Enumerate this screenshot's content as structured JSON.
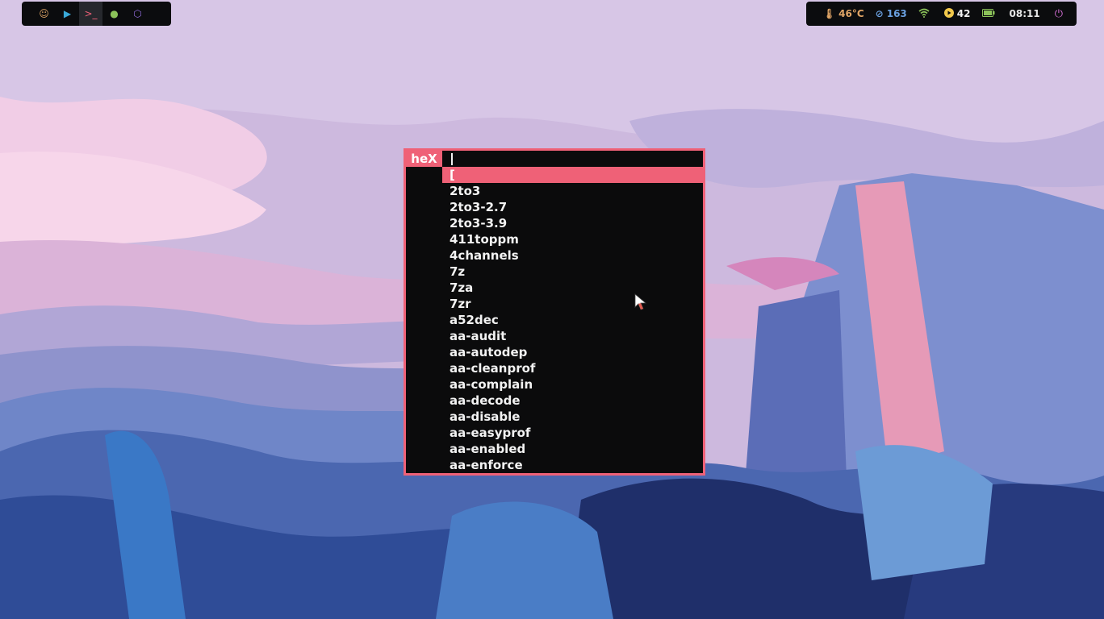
{
  "colors": {
    "accent": "#ef6177",
    "bar_bg": "#0b0c0e",
    "temp": "#e0a566",
    "updates": "#6aa0e0",
    "wifi": "#8cc35a",
    "notif": "#f2c94c",
    "battery": "#8cc35a",
    "power": "#d56fd7"
  },
  "workspaces": [
    {
      "icon": "smile-icon",
      "glyph": "☺",
      "color": "#e0a566"
    },
    {
      "icon": "play-icon",
      "glyph": "▶",
      "color": "#3aa9d8"
    },
    {
      "icon": "terminal-icon",
      "glyph": ">_",
      "color": "#ef6177",
      "active": true
    },
    {
      "icon": "chat-icon",
      "glyph": "●",
      "color": "#8cc35a"
    },
    {
      "icon": "hexagon-icon",
      "glyph": "⬡",
      "color": "#8e6ad6"
    }
  ],
  "status": {
    "temperature": "46°C",
    "updates": "163",
    "notifications": "42",
    "time": "08:11"
  },
  "launcher": {
    "prompt": "heX",
    "query": "",
    "items": [
      "[",
      "2to3",
      "2to3-2.7",
      "2to3-3.9",
      "411toppm",
      "4channels",
      "7z",
      "7za",
      "7zr",
      "a52dec",
      "aa-audit",
      "aa-autodep",
      "aa-cleanprof",
      "aa-complain",
      "aa-decode",
      "aa-disable",
      "aa-easyprof",
      "aa-enabled",
      "aa-enforce"
    ],
    "selected_index": 0
  }
}
